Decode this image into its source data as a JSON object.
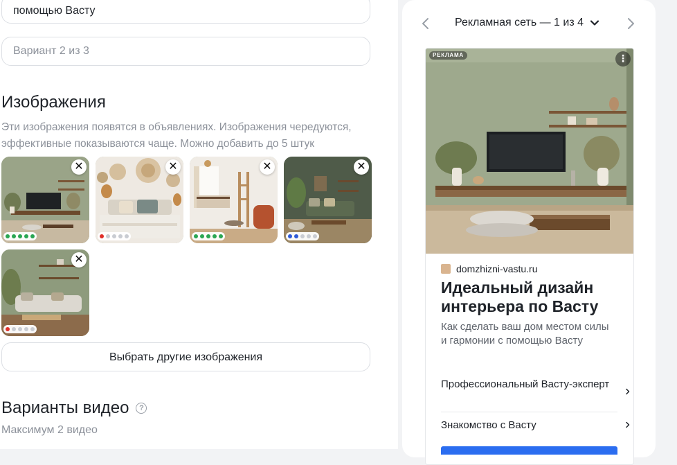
{
  "editor": {
    "text_field_tail": "помощью Васту",
    "variant_field": "Вариант 2 из 3",
    "images_section": {
      "title": "Изображения",
      "description": "Эти изображения появятся в объявлениях. Изображения чередуются, эффективные показываются чаще. Можно добавить до 5 штук",
      "choose_button": "Выбрать другие изображения",
      "remove_icon": "close-icon",
      "thumbnails": [
        {
          "dots": [
            "#2aa653",
            "#2aa653",
            "#2aa653",
            "#2aa653",
            "#2aa653"
          ]
        },
        {
          "dots": [
            "#e0302a",
            "#c9ccd2",
            "#c9ccd2",
            "#c9ccd2",
            "#c9ccd2"
          ]
        },
        {
          "dots": [
            "#2aa653",
            "#2aa653",
            "#2aa653",
            "#2aa653",
            "#2aa653"
          ]
        },
        {
          "dots": [
            "#2f5bd8",
            "#2f5bd8",
            "#c9ccd2",
            "#c9ccd2",
            "#c9ccd2"
          ]
        },
        {
          "dots": [
            "#e0302a",
            "#c9ccd2",
            "#c9ccd2",
            "#c9ccd2",
            "#c9ccd2"
          ]
        }
      ]
    },
    "video_section": {
      "title": "Варианты видео",
      "help_icon": "question-circle-icon",
      "max_note": "Максимум 2 видео"
    }
  },
  "preview": {
    "nav_title": "Рекламная сеть — 1 из 4",
    "nav_prev_icon": "chevron-left-icon",
    "nav_next_icon": "chevron-right-icon",
    "nav_dropdown_icon": "chevron-down-icon",
    "ad": {
      "label": "РЕКЛАМА",
      "menu_icon": "more-vertical-icon",
      "domain": "domzhizni-vastu.ru",
      "title": "Идеальный дизайн интерьера по Васту",
      "text": "Как сделать ваш дом местом силы и гармонии с помощью Васту",
      "sitelinks": [
        {
          "label": "Профессиональный Васту-эксперт"
        },
        {
          "label": "Знакомство с Васту"
        }
      ],
      "accent_color": "#2b6df0"
    }
  }
}
